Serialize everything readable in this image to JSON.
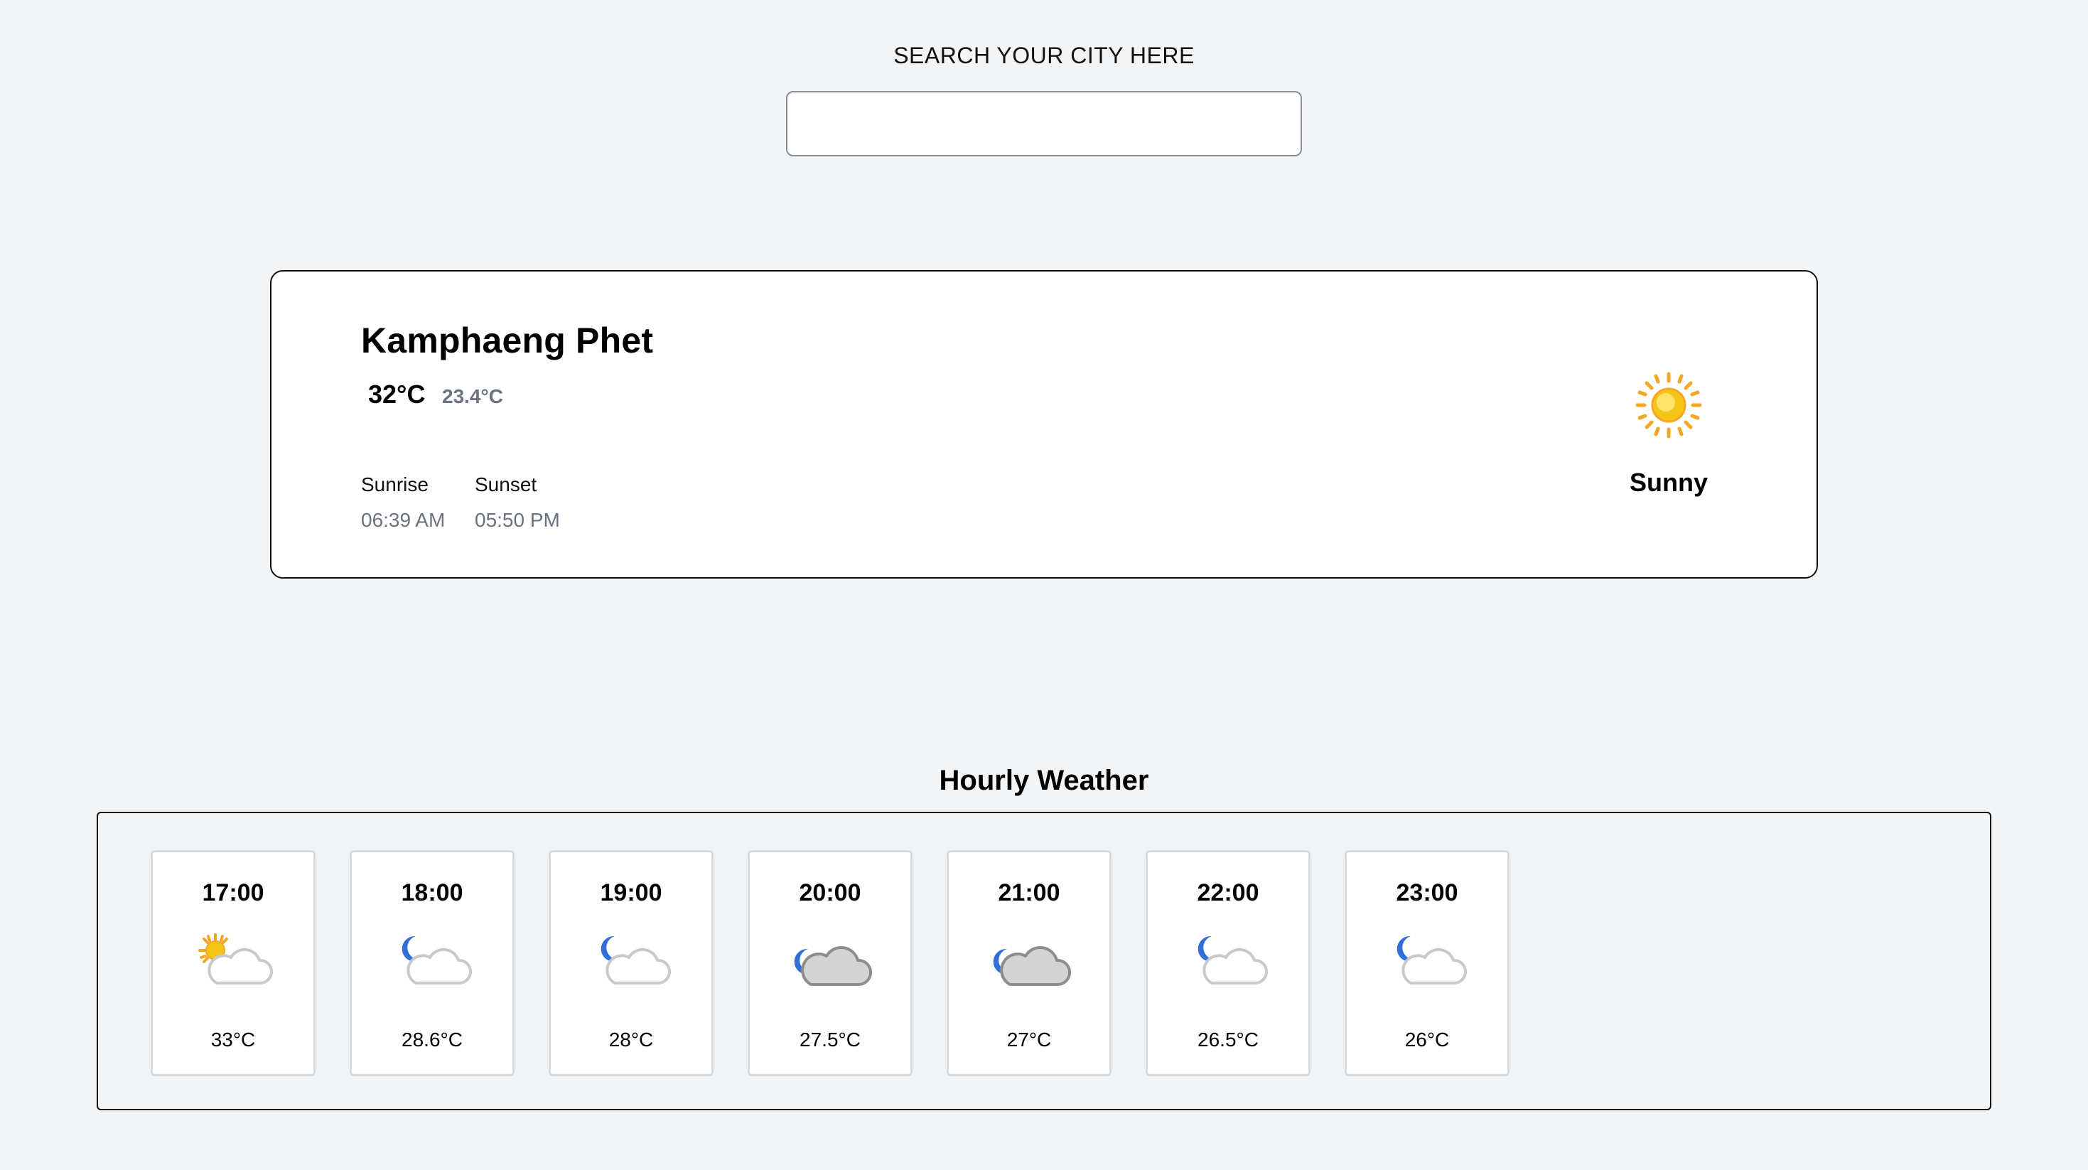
{
  "search": {
    "label": "SEARCH YOUR CITY HERE",
    "value": "",
    "placeholder": ""
  },
  "current": {
    "city": "Kamphaeng Phet",
    "temperature": "32°C",
    "feels_like": "23.4°C",
    "sunrise_label": "Sunrise",
    "sunrise_time": "06:39 AM",
    "sunset_label": "Sunset",
    "sunset_time": "05:50 PM",
    "condition_icon": "sun-icon",
    "condition": "Sunny"
  },
  "hourly": {
    "title": "Hourly Weather",
    "items": [
      {
        "time": "17:00",
        "icon": "sun-behind-cloud-icon",
        "temp": "33°C"
      },
      {
        "time": "18:00",
        "icon": "moon-cloud-icon",
        "temp": "28.6°C"
      },
      {
        "time": "19:00",
        "icon": "moon-cloud-icon",
        "temp": "28°C"
      },
      {
        "time": "20:00",
        "icon": "moon-dark-cloud-icon",
        "temp": "27.5°C"
      },
      {
        "time": "21:00",
        "icon": "moon-dark-cloud-icon",
        "temp": "27°C"
      },
      {
        "time": "22:00",
        "icon": "moon-cloud-icon",
        "temp": "26.5°C"
      },
      {
        "time": "23:00",
        "icon": "moon-cloud-icon",
        "temp": "26°C"
      }
    ]
  },
  "colors": {
    "background": "#f3f4f6",
    "muted_text": "#6b7280",
    "sun": "#f5c518",
    "moon": "#2f6fd6",
    "cloud_light": "#ffffff",
    "cloud_dark": "#d4d4d4"
  }
}
